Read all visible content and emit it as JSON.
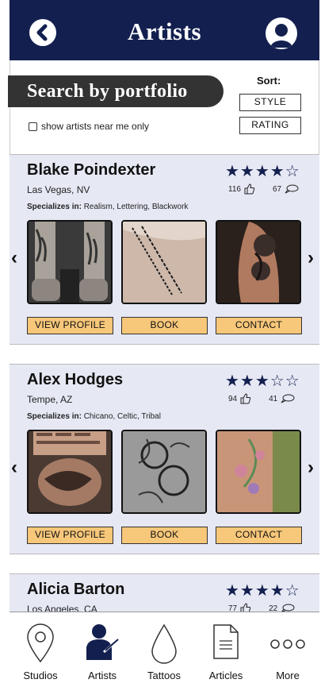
{
  "header": {
    "title": "Artists"
  },
  "search": {
    "label": "Search by portfolio",
    "near_me_label": "show artists near me only"
  },
  "sort": {
    "label": "Sort:",
    "options": [
      "STYLE",
      "RATING"
    ]
  },
  "actions": {
    "view_profile": "VIEW PROFILE",
    "book": "BOOK",
    "contact": "CONTACT"
  },
  "artists": [
    {
      "name": "Blake Poindexter",
      "location": "Las Vegas, NV",
      "specializes_label": "Specializes in:",
      "specialties": "Realism, Lettering, Blackwork",
      "stars": "★★★★☆",
      "rating": 4,
      "likes": "116",
      "comments": "67"
    },
    {
      "name": "Alex Hodges",
      "location": "Tempe, AZ",
      "specializes_label": "Specializes in:",
      "specialties": "Chicano, Celtic, Tribal",
      "stars": "★★★☆☆",
      "rating": 3,
      "likes": "94",
      "comments": "41"
    },
    {
      "name": "Alicia Barton",
      "location": "Los Angeles, CA",
      "stars": "★★★★☆",
      "rating": 4,
      "likes": "77",
      "comments": "22"
    }
  ],
  "nav": {
    "items": [
      "Studios",
      "Artists",
      "Tattoos",
      "Articles",
      "More"
    ]
  },
  "colors": {
    "navy": "#13204f",
    "card_bg": "#e6e8f4",
    "action_bg": "#f7c77a",
    "pill_bg": "#333333"
  }
}
